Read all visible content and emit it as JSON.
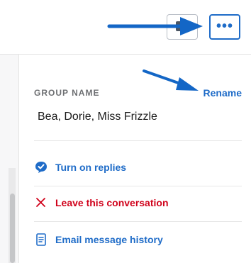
{
  "group_name_section": {
    "label": "GROUP NAME",
    "rename_label": "Rename",
    "name_value": "Bea, Dorie, Miss Frizzle"
  },
  "actions": [
    {
      "label": "Turn on replies",
      "icon": "chat-bubble-check-icon",
      "color": "#1f6cc8"
    },
    {
      "label": "Leave this conversation",
      "icon": "close-x-icon",
      "color": "#d0021b"
    },
    {
      "label": "Email message history",
      "icon": "document-icon",
      "color": "#1f6cc8"
    }
  ],
  "toolbar": {
    "expand_icon": "panel-toggle-icon",
    "more_icon": "more-dots-icon",
    "more_label": "•••"
  },
  "colors": {
    "accent": "#1f6cc8",
    "danger": "#d0021b",
    "annotation_arrow": "#1366c6"
  }
}
